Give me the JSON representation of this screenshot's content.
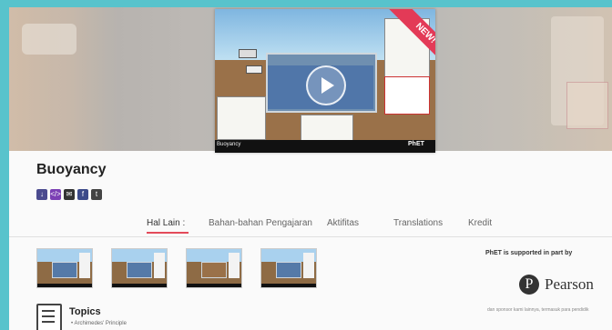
{
  "video": {
    "ribbon": "NEW!",
    "caption": "Buoyancy",
    "phet_logo": "PhET"
  },
  "sim": {
    "title": "Buoyancy"
  },
  "share_icons": [
    "download-icon",
    "embed-icon",
    "email-icon",
    "facebook-icon",
    "twitter-icon"
  ],
  "tabs": [
    {
      "label": "Hal Lain :"
    },
    {
      "label": "Bahan-bahan Pengajaran"
    },
    {
      "label": "Aktifitas"
    },
    {
      "label": "Translations"
    },
    {
      "label": "Kredit"
    }
  ],
  "sidebar": {
    "support_text": "PhET is supported in part by",
    "sponsor_name": "Pearson",
    "fine_print": "dan sponsor kami lainnya, termasuk para pendidik"
  },
  "topics": {
    "title": "Topics",
    "items": [
      "Archimedes' Principle"
    ]
  },
  "colors": {
    "background": "#58c3cc",
    "tab_accent": "#e34a5a",
    "ribbon": "#e33a57"
  }
}
